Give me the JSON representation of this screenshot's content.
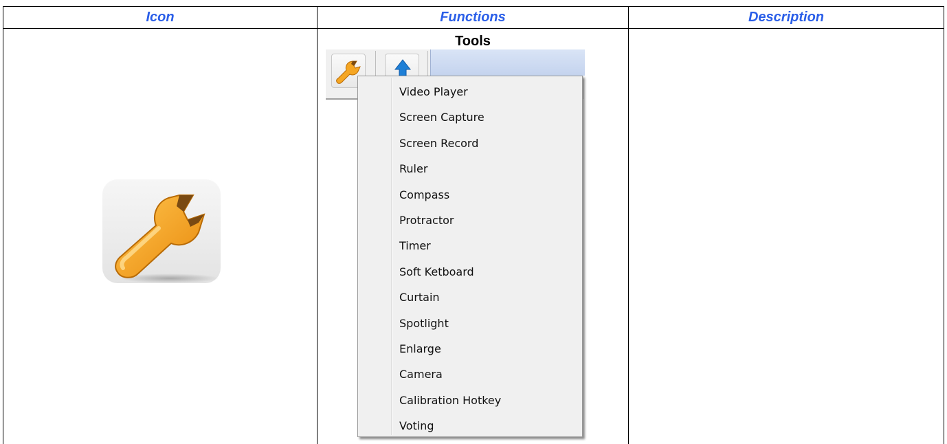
{
  "headers": {
    "icon": "Icon",
    "functions": "Functions",
    "description": "Description"
  },
  "section": {
    "title": "Tools"
  },
  "icons": {
    "large_tile": "wrench-icon",
    "toolbar_tools": "wrench-icon",
    "toolbar_up": "up-arrow-icon"
  },
  "colors": {
    "header_text": "#2a5ee8",
    "wrench_orange": "#f5a623",
    "toolbar_blue": "#c4d3ee",
    "arrow_blue": "#1e7fd6"
  },
  "menu": {
    "items": [
      "Video Player",
      "Screen Capture",
      "Screen Record",
      "Ruler",
      "Compass",
      "Protractor",
      "Timer",
      "Soft Ketboard",
      "Curtain",
      "Spotlight",
      "Enlarge",
      "Camera",
      "Calibration Hotkey",
      "Voting"
    ]
  },
  "description_cell": {
    "text": ""
  }
}
